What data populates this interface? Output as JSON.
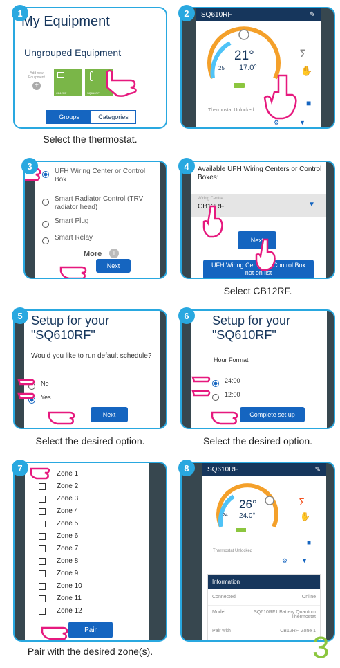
{
  "steps": {
    "s1": {
      "num": "1",
      "title": "My Equipment",
      "subtitle": "Ungrouped Equipment",
      "add_label": "Add new Equipment",
      "tile1": "CB12RF",
      "tile2": "SQ610RF",
      "tab_groups": "Groups",
      "tab_categories": "Categories",
      "caption": "Select the thermostat."
    },
    "s2": {
      "num": "2",
      "device": "SQ610RF",
      "temp": "21°",
      "set_left": "25",
      "set_right": "17.0°",
      "status": "Thermostat Unlocked"
    },
    "s3": {
      "num": "3",
      "options": [
        "UFH Wiring Center or Control Box",
        "Smart Radiator Control (TRV radiator head)",
        "Smart Plug",
        "Smart Relay"
      ],
      "more": "More",
      "next": "Next"
    },
    "s4": {
      "num": "4",
      "heading": "Available UFH Wiring Centers or Control Boxes:",
      "field_label": "Wiring Centre",
      "field_value": "CB12RF",
      "next": "Next",
      "not_on_list": "UFH Wiring Center or Control Box not on list",
      "caption": "Select CB12RF."
    },
    "s5": {
      "num": "5",
      "title": "Setup for your \"SQ610RF\"",
      "question": "Would you like to run default schedule?",
      "no": "No",
      "yes": "Yes",
      "next": "Next",
      "caption": "Select the desired option."
    },
    "s6": {
      "num": "6",
      "title": "Setup for your \"SQ610RF\"",
      "label": "Hour Format",
      "opt24": "24:00",
      "opt12": "12:00",
      "complete": "Complete set up",
      "caption": "Select the desired option."
    },
    "s7": {
      "num": "7",
      "zones": [
        "Zone 1",
        "Zone 2",
        "Zone 3",
        "Zone 4",
        "Zone 5",
        "Zone 6",
        "Zone 7",
        "Zone 8",
        "Zone 9",
        "Zone 10",
        "Zone 11",
        "Zone 12"
      ],
      "pair": "Pair",
      "caption": "Pair with the desired zone(s)."
    },
    "s8": {
      "num": "8",
      "device": "SQ610RF",
      "temp": "26°",
      "set_left": "24",
      "set_right": "24.0°",
      "status": "Thermostat Unlocked",
      "info_title": "Information",
      "rows": [
        {
          "k": "Connected",
          "v": "Online"
        },
        {
          "k": "Model",
          "v": "SQ610RF1 Battery Quantum Thermostat"
        },
        {
          "k": "Pair with",
          "v": "CB12RF, Zone 1"
        }
      ]
    },
    "page_number": "3"
  },
  "colors": {
    "accent": "#29a8e0",
    "green": "#8cc63f",
    "pink": "#e6197e",
    "blue": "#1565c0",
    "navy": "#16365c"
  }
}
